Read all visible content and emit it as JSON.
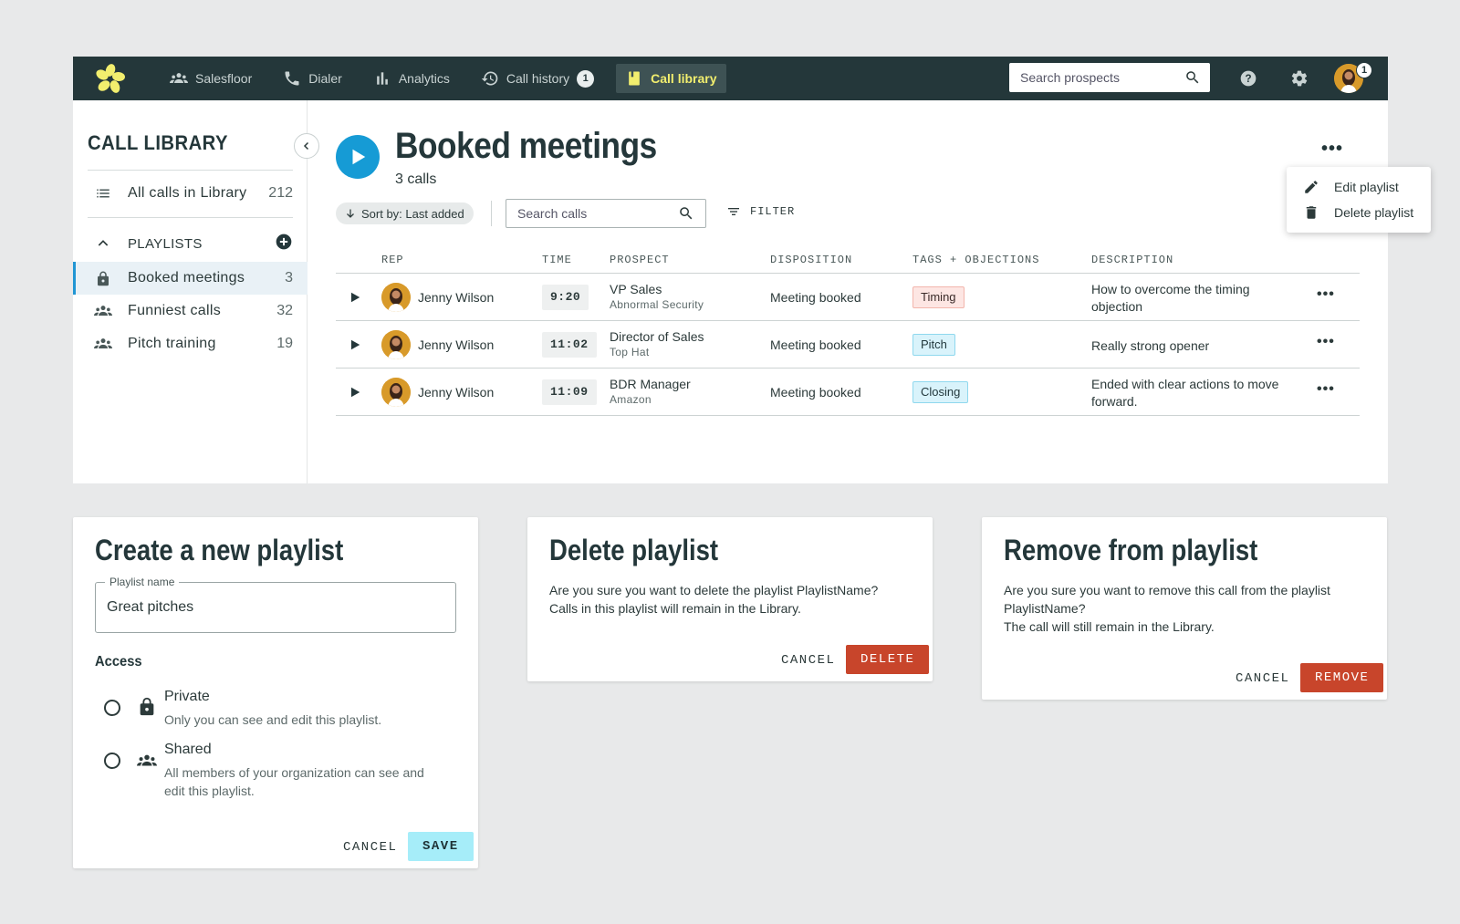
{
  "nav": {
    "items": [
      {
        "label": "Salesfloor"
      },
      {
        "label": "Dialer"
      },
      {
        "label": "Analytics"
      },
      {
        "label": "Call history",
        "badge": "1"
      },
      {
        "label": "Call library"
      }
    ],
    "search_placeholder": "Search prospects",
    "avatar_badge": "1"
  },
  "sidebar": {
    "title": "CALL LIBRARY",
    "all_calls": {
      "label": "All calls in Library",
      "count": "212"
    },
    "playlists_header": "PLAYLISTS",
    "playlists": [
      {
        "label": "Booked meetings",
        "count": "3"
      },
      {
        "label": "Funniest calls",
        "count": "32"
      },
      {
        "label": "Pitch training",
        "count": "19"
      }
    ]
  },
  "main": {
    "title": "Booked meetings",
    "subtitle": "3 calls",
    "sort_label": "Sort by: Last added",
    "search_placeholder": "Search calls",
    "filter_label": "FILTER",
    "menu": {
      "edit": "Edit playlist",
      "delete": "Delete playlist"
    },
    "columns": {
      "rep": "REP",
      "time": "TIME",
      "prospect": "PROSPECT",
      "disposition": "DISPOSITION",
      "tags": "TAGS + OBJECTIONS",
      "description": "DESCRIPTION"
    },
    "rows": [
      {
        "rep": "Jenny Wilson",
        "time": "9:20",
        "prospect_title": "VP Sales",
        "prospect_company": "Abnormal Security",
        "disposition": "Meeting booked",
        "tag": "Timing",
        "description": "How to overcome the timing objection"
      },
      {
        "rep": "Jenny Wilson",
        "time": "11:02",
        "prospect_title": "Director of Sales",
        "prospect_company": "Top Hat",
        "disposition": "Meeting booked",
        "tag": "Pitch",
        "description": "Really strong opener"
      },
      {
        "rep": "Jenny Wilson",
        "time": "11:09",
        "prospect_title": "BDR Manager",
        "prospect_company": "Amazon",
        "disposition": "Meeting booked",
        "tag": "Closing",
        "description": "Ended with clear actions to move forward."
      }
    ]
  },
  "create_dialog": {
    "title": "Create a new playlist",
    "field_label": "Playlist name",
    "field_value": "Great pitches",
    "access_label": "Access",
    "private_title": "Private",
    "private_desc": "Only you can see and edit this playlist.",
    "shared_title": "Shared",
    "shared_desc": "All members of your organization can see and edit this playlist.",
    "cancel": "CANCEL",
    "save": "SAVE"
  },
  "delete_dialog": {
    "title": "Delete playlist",
    "line1": "Are you sure you want to delete the playlist PlaylistName?",
    "line2": "Calls in this playlist will remain in the Library.",
    "cancel": "CANCEL",
    "confirm": "DELETE"
  },
  "remove_dialog": {
    "title": "Remove from playlist",
    "line1": "Are you sure you want to remove this call from the playlist PlaylistName?",
    "line2": "The call will still remain in the Library.",
    "cancel": "CANCEL",
    "confirm": "REMOVE"
  },
  "colors": {
    "topbar": "#24373a",
    "active_nav_text": "#f2ee6e",
    "play_blue": "#169bd5",
    "danger": "#c8452b",
    "save_cyan": "#a6edf9",
    "tag_red_bg": "#fde6e3",
    "tag_blue_bg": "#d9f3fb"
  },
  "icons": [
    "logo-icon",
    "people-icon",
    "phone-icon",
    "bar-chart-icon",
    "history-icon",
    "bookmark-icon",
    "search-icon",
    "help-icon",
    "gear-icon",
    "list-icon",
    "chevron-up-icon",
    "add-circle-icon",
    "lock-icon",
    "group-icon",
    "play-icon",
    "arrow-down-icon",
    "filter-icon",
    "more-icon",
    "pencil-icon",
    "trash-icon",
    "chevron-left-icon"
  ]
}
